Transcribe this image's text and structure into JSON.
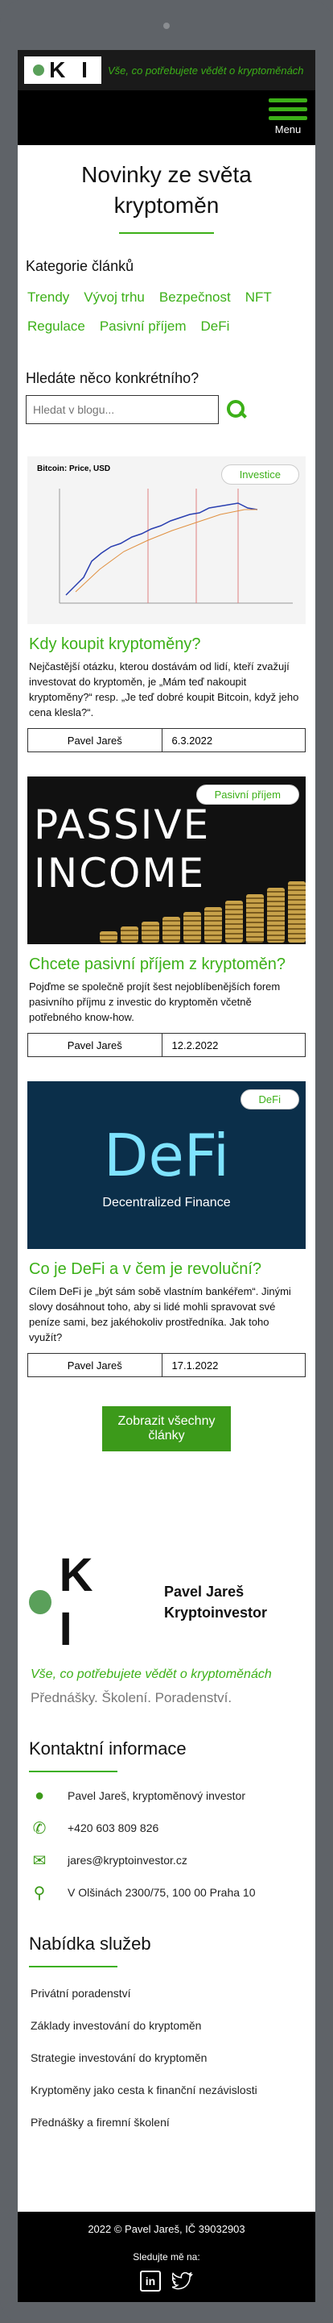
{
  "header": {
    "tagline": "Vše, co potřebujete vědět o kryptoměnách",
    "logo_text": "K I",
    "menu_label": "Menu"
  },
  "page_title": "Novinky ze světa kryptoměn",
  "categories": {
    "heading": "Kategorie článků",
    "items": [
      "Trendy",
      "Vývoj trhu",
      "Bezpečnost",
      "NFT",
      "Regulace",
      "Pasivní příjem",
      "DeFi"
    ]
  },
  "search": {
    "heading": "Hledáte něco konkrétního?",
    "placeholder": "Hledat v blogu..."
  },
  "articles": [
    {
      "badge": "Investice",
      "image_title": "Bitcoin: Price, USD",
      "title": "Kdy koupit kryptoměny?",
      "excerpt": "Nejčastější otázku, kterou dostávám od lidí, kteří zvažují investovat do kryptoměn, je „Mám teď nakoupit kryptoměny?“ resp. „Je teď dobré koupit Bitcoin, když jeho cena klesla?“.",
      "author": "Pavel Jareš",
      "date": "6.3.2022"
    },
    {
      "badge": "Pasivní příjem",
      "image_text_1": "PASSIVE",
      "image_text_2": "INCOME",
      "title": "Chcete pasivní příjem z kryptoměn?",
      "excerpt": "Pojďme se společně projít šest nejoblíbenějších forem pasivního příjmu z investic do kryptoměn včetně potřebného know-how.",
      "author": "Pavel Jareš",
      "date": "12.2.2022"
    },
    {
      "badge": "DeFi",
      "image_text_1": "DeFi",
      "image_text_2": "Decentralized Finance",
      "title": "Co je DeFi a v čem je revoluční?",
      "excerpt": "Cílem DeFi je „být sám sobě vlastním bankéřem“. Jinými slovy dosáhnout toho, aby si lidé mohli spravovat své peníze sami, bez jakéhokoliv prostředníka. Jak toho využít?",
      "author": "Pavel Jareš",
      "date": "17.1.2022"
    }
  ],
  "show_all_label": "Zobrazit všechny články",
  "footer": {
    "name_line1": "Pavel Jareš",
    "name_line2": "Kryptoinvestor",
    "tagline": "Vše, co potřebujete vědět o kryptoměnách",
    "subtitle": "Přednášky. Školení. Poradenství.",
    "contact_heading": "Kontaktní informace",
    "contacts": {
      "person": "Pavel Jareš, kryptoměnový investor",
      "phone": "+420 603 809 826",
      "email": "jares@kryptoinvestor.cz",
      "address": "V Olšinách 2300/75, 100 00 Praha 10"
    },
    "services_heading": "Nabídka služeb",
    "services": [
      "Privátní poradenství",
      "Základy investování do kryptoměn",
      "Strategie investování do kryptoměn",
      "Kryptoměny jako cesta k finanční nezávislosti",
      "Přednášky a firemní školení"
    ],
    "copyright": "2022 © Pavel Jareš, IČ 39032903",
    "follow_label": "Sledujte mě na:"
  }
}
